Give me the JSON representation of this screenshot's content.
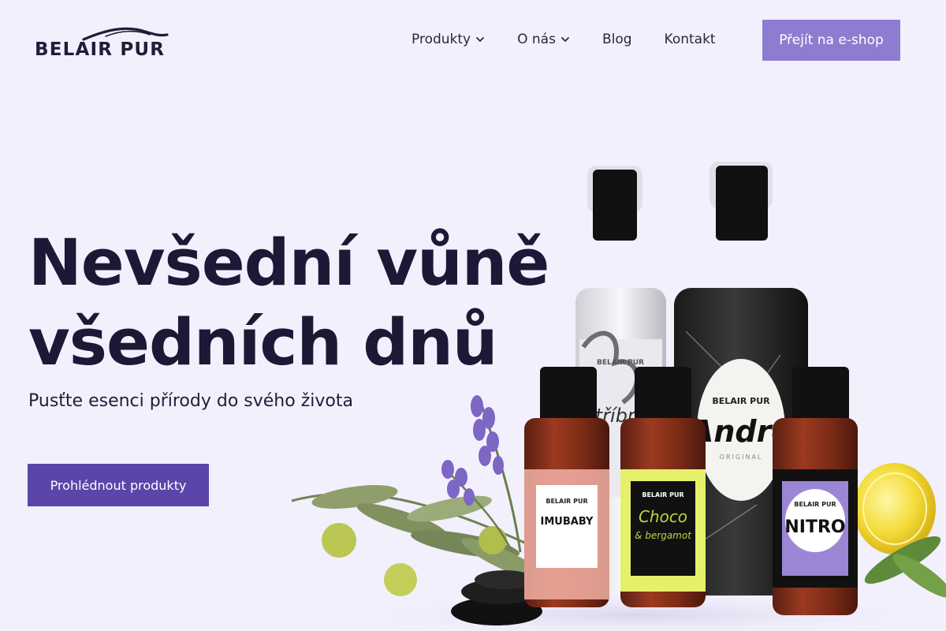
{
  "header": {
    "logo_text": "BELAIR PUR",
    "nav": [
      {
        "label": "Produkty",
        "has_dropdown": true,
        "icon": "chevron-down-icon"
      },
      {
        "label": "O nás",
        "has_dropdown": true,
        "icon": "chevron-down-icon"
      },
      {
        "label": "Blog",
        "has_dropdown": false
      },
      {
        "label": "Kontakt",
        "has_dropdown": false
      }
    ],
    "shop_button": "Přejít na e-shop"
  },
  "hero": {
    "title_line1": "Nevšední vůně",
    "title_line2": "všedních dnů",
    "subtitle": "Pusťte esenci přírody do svého života",
    "cta": "Prohlédnout produkty"
  },
  "products": {
    "brand": "BELAIR PUR",
    "labels": {
      "imubaby": "IMUBABY",
      "choco_line1": "Choco",
      "choco_line2": "& bergamot",
      "andre": "André",
      "andre_sub": "ORIGINAL",
      "nitro": "NITRO",
      "stribro": "Stříbro"
    }
  },
  "colors": {
    "background": "#f2f0fd",
    "accent_light": "#8d7cd0",
    "accent_dark": "#5b45a8",
    "text_dark": "#1c1836"
  }
}
